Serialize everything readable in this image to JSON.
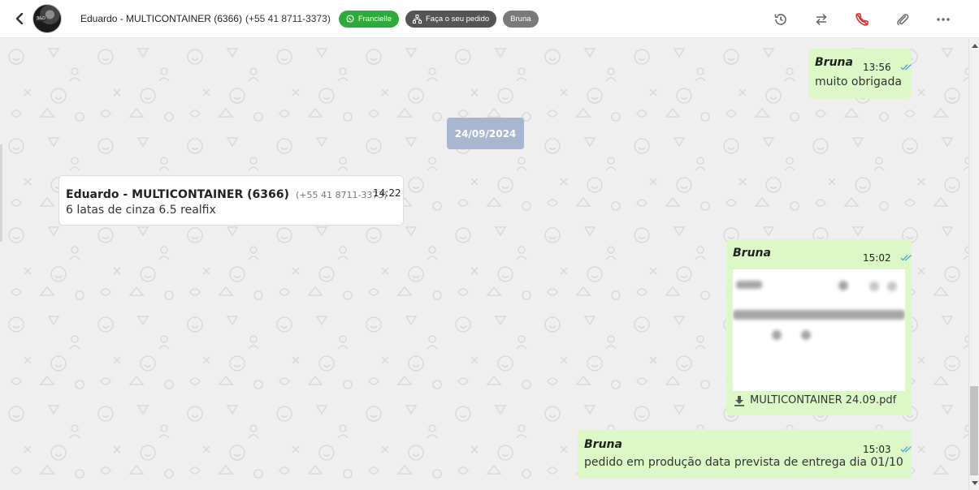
{
  "header": {
    "contact_name": "Eduardo - MULTICONTAINER (6366)",
    "contact_phone": "(+55 41 8711-3373)",
    "tags": [
      {
        "label": "Francielle",
        "icon": "whatsapp-icon",
        "color": "#2eaa3a"
      },
      {
        "label": "Faça o seu pedido",
        "icon": "flow-icon",
        "color": "#555555"
      },
      {
        "label": "Bruna",
        "color": "#7a7a7a"
      }
    ],
    "actions": [
      "history-icon",
      "transfer-icon",
      "end-call-icon",
      "attach-icon",
      "more-icon"
    ]
  },
  "messages": {
    "m1": {
      "sender": "Bruna",
      "time": "13:56",
      "text": "muito obrigada"
    },
    "date_separator": "24/09/2024",
    "m2": {
      "sender": "Eduardo - MULTICONTAINER (6366)",
      "phone": "(+55 41 8711-3373)",
      "time": "14:22",
      "text": "6 latas de cinza 6.5 realfix"
    },
    "m3": {
      "sender": "Bruna",
      "time": "15:02",
      "file_name": "MULTICONTAINER 24.09.pdf"
    },
    "m4": {
      "sender": "Bruna",
      "time": "15:03",
      "text": "pedido em produção data prevista de entrega dia 01/10"
    }
  },
  "colors": {
    "outgoing_bubble": "#dcf8c6",
    "incoming_bubble": "#ffffff",
    "date_chip": "#a9b6d2",
    "read_ticks": "#4fa3e0",
    "end_call": "#d32f2f"
  }
}
